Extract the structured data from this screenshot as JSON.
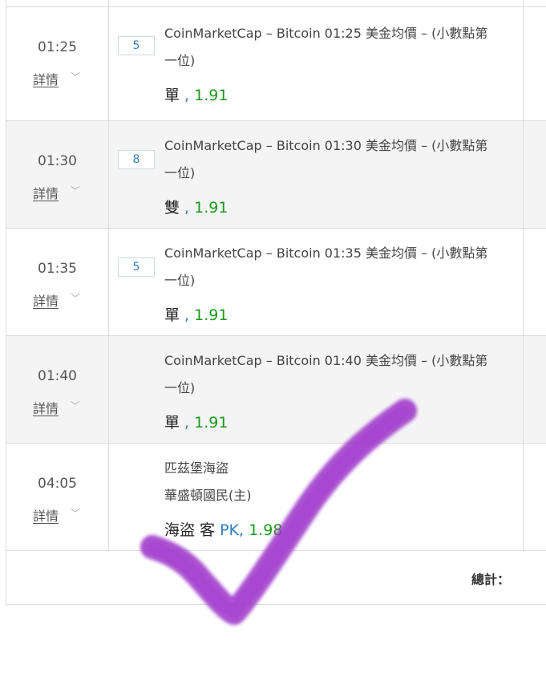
{
  "rows": [
    {
      "time": "01:25",
      "detail": "詳情",
      "number": "5",
      "desc_line1": "CoinMarketCap – Bitcoin 01:25 美金均價 – (小數點第",
      "desc_line2": "一位)",
      "pick": "單",
      "sep": " , ",
      "odds": "1.91"
    },
    {
      "time": "01:30",
      "detail": "詳情",
      "number": "8",
      "desc_line1": "CoinMarketCap – Bitcoin 01:30 美金均價 – (小數點第",
      "desc_line2": "一位)",
      "pick": "雙",
      "sep": " , ",
      "odds": "1.91"
    },
    {
      "time": "01:35",
      "detail": "詳情",
      "number": "5",
      "desc_line1": "CoinMarketCap – Bitcoin 01:35 美金均價 – (小數點第",
      "desc_line2": "一位)",
      "pick": "單",
      "sep": " , ",
      "odds": "1.91"
    },
    {
      "time": "01:40",
      "detail": "詳情",
      "desc_line1": "CoinMarketCap – Bitcoin 01:40 美金均價 – (小數點第",
      "desc_line2": "一位)",
      "pick": "單",
      "sep": " , ",
      "odds": "1.91"
    },
    {
      "time": "04:05",
      "detail": "詳情",
      "desc_line1": "匹茲堡海盜",
      "desc_line2": "華盛頓國民(主)",
      "pick": "海盜 客",
      "market": " PK",
      "sep": ", ",
      "odds": "1.98"
    }
  ],
  "footer": {
    "total_label": "總計："
  },
  "icons": {
    "expand": "chevron-down-icon"
  },
  "colors": {
    "odds": "#1a9a1a",
    "link_blue": "#2f7fc1",
    "check_mark": "#9b30c8"
  }
}
